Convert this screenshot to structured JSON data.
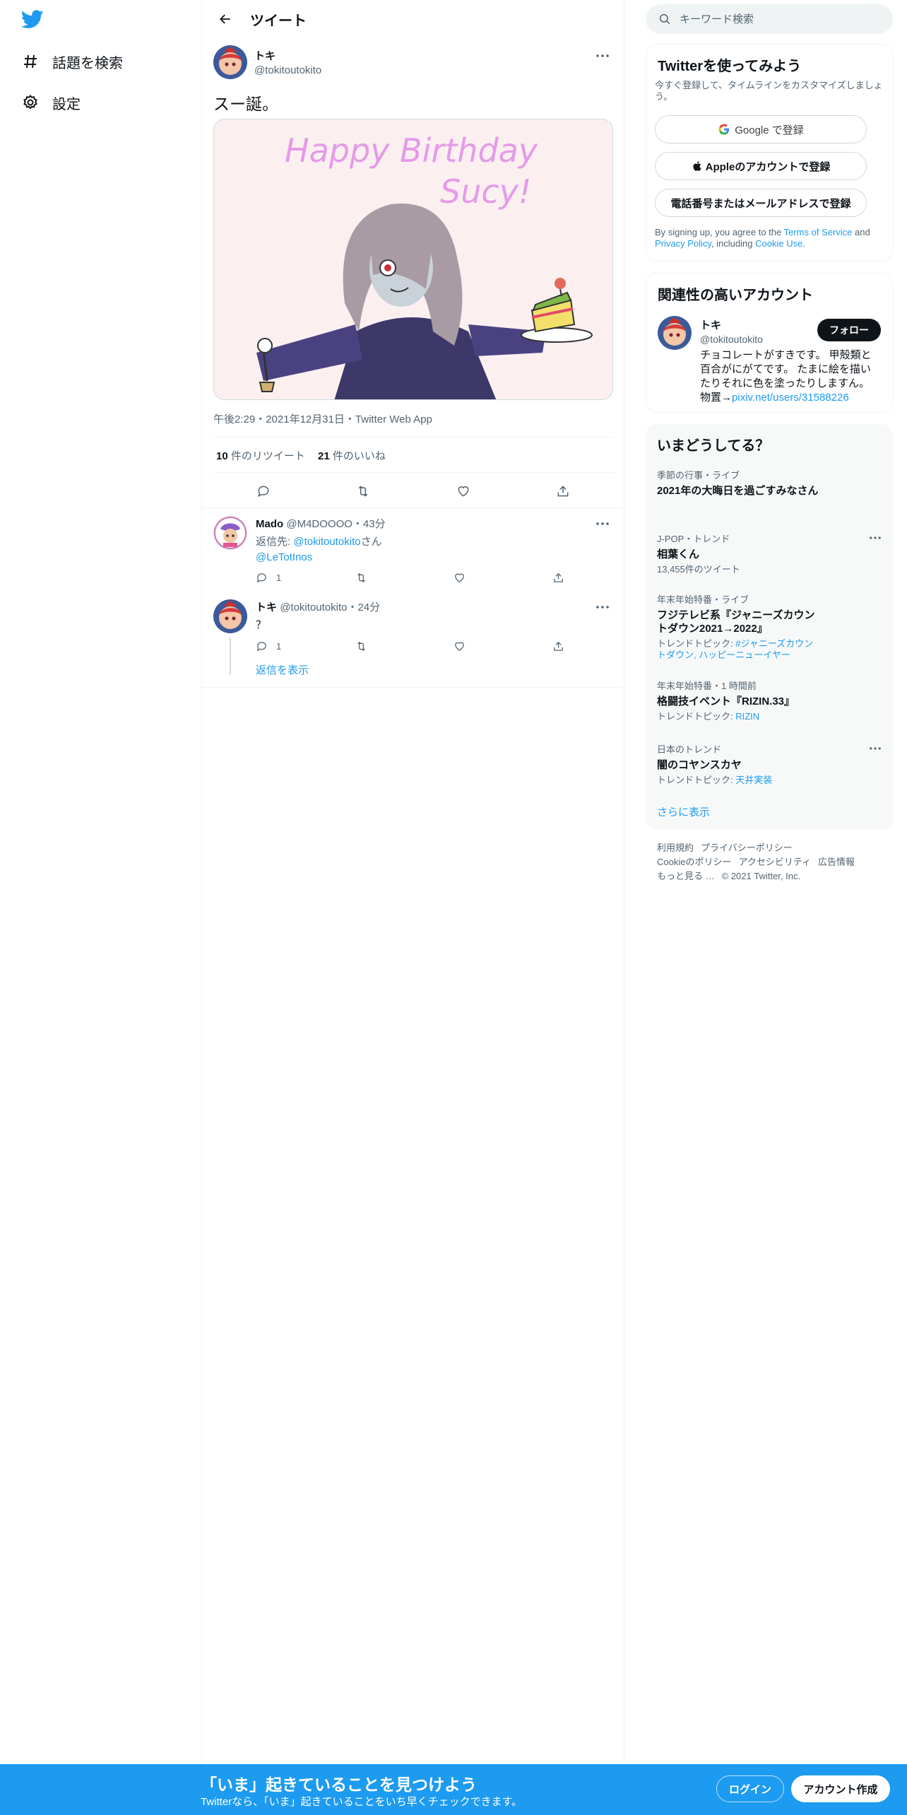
{
  "nav": {
    "logo_icon": "twitter-bird-icon",
    "items": [
      {
        "label": "話題を検索",
        "icon": "hashtag-icon"
      },
      {
        "label": "設定",
        "icon": "gear-icon"
      }
    ]
  },
  "header": {
    "title": "ツイート",
    "back_icon": "arrow-left-icon"
  },
  "tweet": {
    "author_name": "トキ",
    "author_handle": "@tokitoutokito",
    "text": "スー誕。",
    "image_text_line1": "Happy Birthday",
    "image_text_line2": "Sucy!",
    "meta": "午後2:29・2021年12月31日・Twitter Web App",
    "retweet_count": "10",
    "retweet_label": " 件のリツイート",
    "like_count": "21",
    "like_label": " 件のいいね"
  },
  "replies": [
    {
      "name": "Mado",
      "handle": "@M4DOOOO",
      "time": "・43分",
      "reply_prefix": "返信先: ",
      "reply_to": "@tokitoutokito",
      "reply_suffix": "さん",
      "mention2": "@LeTotInos",
      "reply_count": "1"
    },
    {
      "name": "トキ",
      "handle": "@tokitoutokito",
      "time": "・24分",
      "text": "？",
      "reply_count": "1",
      "show_replies": "返信を表示"
    }
  ],
  "search": {
    "placeholder": "キーワード検索"
  },
  "signup_card": {
    "title": "Twitterを使ってみよう",
    "subtitle": "今すぐ登録して、タイムラインをカスタマイズしましょう。",
    "google_btn": "Google で登録",
    "apple_btn": "Appleのアカウントで登録",
    "phone_btn": "電話番号またはメールアドレスで登録",
    "terms_prefix": "By signing up, you agree to the ",
    "terms_link": "Terms of Service",
    "terms_and": " and ",
    "privacy_link": "Privacy Policy",
    "including": ", including ",
    "cookie_link": "Cookie Use",
    "period": "."
  },
  "related_card": {
    "title": "関連性の高いアカウント",
    "name": "トキ",
    "handle": "@tokitoutokito",
    "follow_btn": "フォロー",
    "bio_line1": "チョコレートがすきです。 甲殻類と",
    "bio_line2": "百合がにがてです。 たまに絵を描い",
    "bio_line3": "たりそれに色を塗ったりしますん。",
    "bio_prefix": "物置→",
    "bio_link": "pixiv.net/users/31588226"
  },
  "trends": {
    "title": "いまどうしてる？",
    "items": [
      {
        "category": "季節の行事・ライブ",
        "title": "2021年の大晦日を過ごすみなさん"
      },
      {
        "category": "J-POP・トレンド",
        "title": "相葉くん",
        "sub": "13,455件のツイート"
      },
      {
        "category": "年末年始特番・ライブ",
        "title_line1": "フジテレビ系『ジャニーズカウン",
        "title_line2": "トダウン2021→2022』",
        "sub_prefix": "トレンドトピック: ",
        "sub_link_line1": "#ジャニーズカウン",
        "sub_link_line2": "トダウン, ハッピーニューイヤー"
      },
      {
        "category": "年末年始特番・1 時間前",
        "title": "格闘技イベント『RIZIN.33』",
        "sub_prefix": "トレンドトピック: ",
        "sub_link": "RIZIN"
      },
      {
        "category": "日本のトレンド",
        "title": "闇のコヤンスカヤ",
        "sub_prefix": "トレンドトピック: ",
        "sub_link": "天井実装"
      }
    ],
    "show_more": "さらに表示"
  },
  "footer": {
    "links_row1": [
      "利用規約",
      "プライバシーポリシー"
    ],
    "links_row2": [
      "Cookieのポリシー",
      "アクセシビリティ",
      "広告情報"
    ],
    "more": "もっと見る …",
    "copyright": "© 2021 Twitter, Inc."
  },
  "bottom_bar": {
    "title": "「いま」起きていることを見つけよう",
    "subtitle": "Twitterなら、「いま」起きていることをいち早くチェックできます。",
    "login": "ログイン",
    "signup": "アカウント作成"
  },
  "colors": {
    "accent": "#1d9bf0",
    "text": "#0f1419",
    "muted": "#536471",
    "border": "#eff3f4",
    "bottom_bar": "#1d9bf0"
  }
}
